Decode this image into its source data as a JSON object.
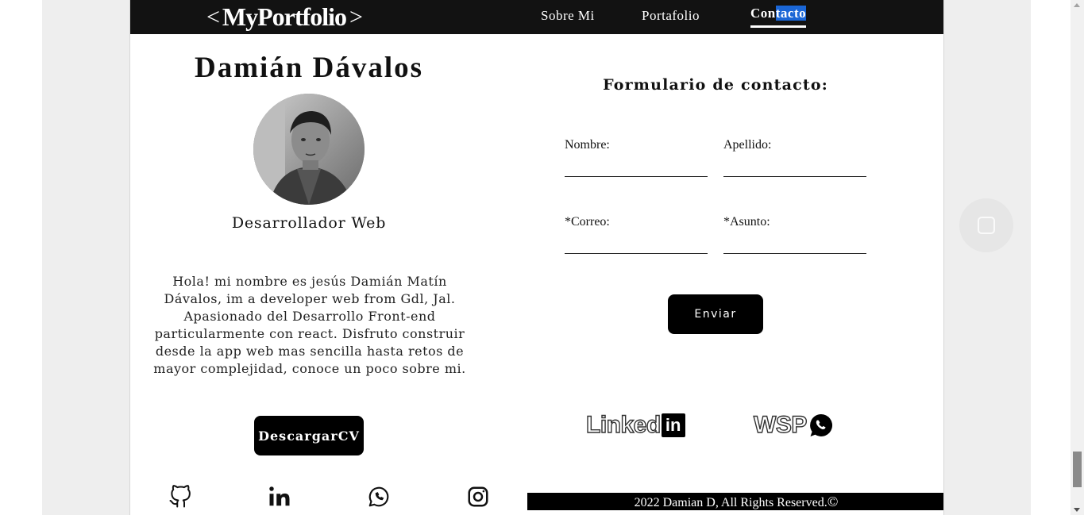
{
  "nav": {
    "logo_open": "<",
    "logo_text": "MyPortfolio",
    "logo_close": ">",
    "links": [
      {
        "label": "Sobre Mi"
      },
      {
        "label": "Portafolio"
      },
      {
        "label_a": "Con",
        "label_b": "tacto",
        "active": true
      }
    ]
  },
  "profile": {
    "name": "Damián Dávalos",
    "role": "Desarrollador Web",
    "bio": "Hola! mi nombre es jesús Damián Matín Dávalos, im a developer web from Gdl, Jal. Apasionado del Desarrollo Front-end particularmente con react. Disfruto construir desde la app web mas sencilla hasta retos de mayor complejidad, conoce un poco sobre mi.",
    "cv_button": "DescargarCV"
  },
  "social_icons": [
    "github-icon",
    "linkedin-icon",
    "whatsapp-icon",
    "instagram-icon"
  ],
  "form": {
    "title": "Formulario de contacto:",
    "fields": {
      "nombre": {
        "label": "Nombre:",
        "value": ""
      },
      "apellido": {
        "label": "Apellido:",
        "value": ""
      },
      "correo": {
        "label": "*Correo:",
        "value": ""
      },
      "asunto": {
        "label": "*Asunto:",
        "value": ""
      }
    },
    "submit": "Enviar"
  },
  "contact_links": {
    "linkedin_text": "Linked",
    "linkedin_badge": "in",
    "wsp_text": "WSP"
  },
  "footer": {
    "text": "2022 Damian D, All Rights Reserved.",
    "copyright_symbol": "©"
  },
  "colors": {
    "nav_bg": "#121212",
    "button_bg": "#000000",
    "selection": "#1a66d6",
    "page_bg": "#ffffff"
  }
}
